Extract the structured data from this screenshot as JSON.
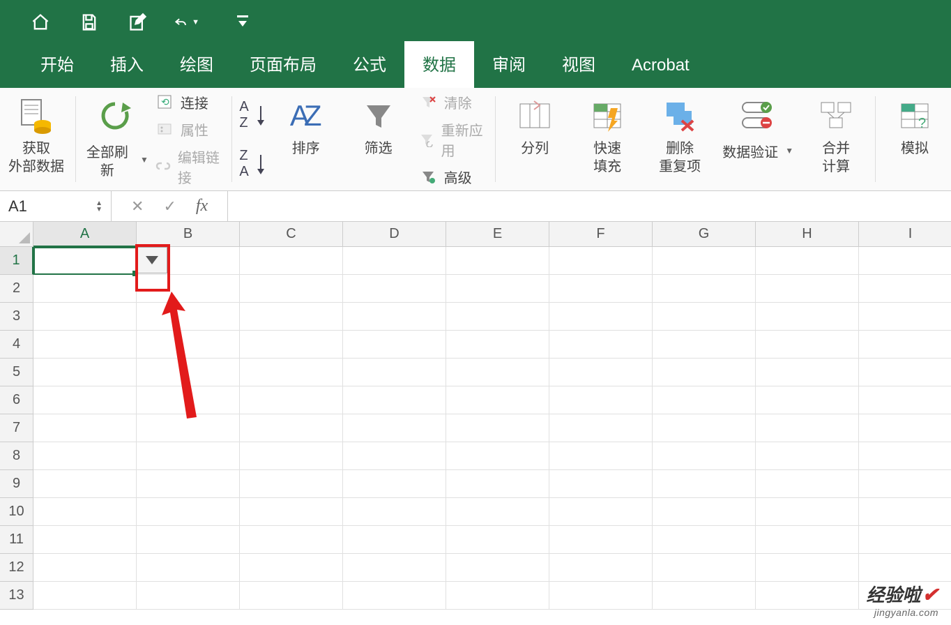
{
  "titlebar": {
    "icons": [
      "home",
      "save",
      "edit",
      "undo",
      "customize"
    ]
  },
  "tabs": {
    "items": [
      {
        "label": "开始"
      },
      {
        "label": "插入"
      },
      {
        "label": "绘图"
      },
      {
        "label": "页面布局"
      },
      {
        "label": "公式"
      },
      {
        "label": "数据",
        "active": true
      },
      {
        "label": "审阅"
      },
      {
        "label": "视图"
      },
      {
        "label": "Acrobat"
      }
    ]
  },
  "ribbon": {
    "get_external": "获取\n外部数据",
    "refresh_all": "全部刷新",
    "connections": {
      "c1": "连接",
      "c2": "属性",
      "c3": "编辑链接"
    },
    "sort": "排序",
    "filter": "筛选",
    "filter_opts": {
      "f1": "清除",
      "f2": "重新应用",
      "f3": "高级"
    },
    "text_to_columns": "分列",
    "flash_fill": "快速\n填充",
    "remove_dup": "删除\n重复项",
    "data_validation": "数据验证",
    "consolidate": "合并\n计算",
    "what_if": "模拟"
  },
  "formula_bar": {
    "namebox": "A1",
    "formula": ""
  },
  "sheet": {
    "columns": [
      "A",
      "B",
      "C",
      "D",
      "E",
      "F",
      "G",
      "H",
      "I"
    ],
    "rows": [
      "1",
      "2",
      "3",
      "4",
      "5",
      "6",
      "7",
      "8",
      "9",
      "10",
      "11",
      "12",
      "13"
    ],
    "selected_cell": "A1"
  },
  "watermark": {
    "line1": "经验啦",
    "line2": "jingyanla.com"
  }
}
